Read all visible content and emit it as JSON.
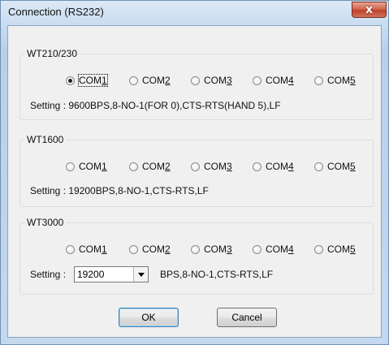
{
  "window": {
    "title": "Connection (RS232)",
    "close_glyph": "x"
  },
  "groups": [
    {
      "label": "WT210/230",
      "ports": [
        "COM",
        "COM",
        "COM",
        "COM",
        "COM"
      ],
      "port_keys": [
        "1",
        "2",
        "3",
        "4",
        "5"
      ],
      "selected_index": 0,
      "setting": "Setting : 9600BPS,8-NO-1(FOR 0),CTS-RTS(HAND 5),LF"
    },
    {
      "label": "WT1600",
      "ports": [
        "COM",
        "COM",
        "COM",
        "COM",
        "COM"
      ],
      "port_keys": [
        "1",
        "2",
        "3",
        "4",
        "5"
      ],
      "selected_index": -1,
      "setting": "Setting : 19200BPS,8-NO-1,CTS-RTS,LF"
    },
    {
      "label": "WT3000",
      "ports": [
        "COM",
        "COM",
        "COM",
        "COM",
        "COM"
      ],
      "port_keys": [
        "1",
        "2",
        "3",
        "4",
        "5"
      ],
      "selected_index": -1,
      "setting_label": "Setting :",
      "baud_value": "19200",
      "setting_suffix": "BPS,8-NO-1,CTS-RTS,LF"
    }
  ],
  "buttons": {
    "ok": "OK",
    "cancel": "Cancel"
  }
}
